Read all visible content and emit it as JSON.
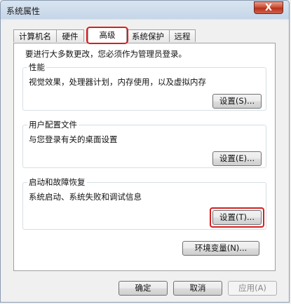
{
  "window": {
    "title": "系统属性",
    "close_glyph": "X"
  },
  "tabs": [
    "计算机名",
    "硬件",
    "高级",
    "系统保护",
    "远程"
  ],
  "admin_note": "要进行大多数更改，您必须作为管理员登录。",
  "performance": {
    "title": "性能",
    "desc": "视觉效果，处理器计划，内存使用，以及虚拟内存",
    "button": "设置(S)..."
  },
  "profiles": {
    "title": "用户配置文件",
    "desc": "与您登录有关的桌面设置",
    "button": "设置(E)..."
  },
  "startup": {
    "title": "启动和故障恢复",
    "desc": "系统启动、系统失败和调试信息",
    "button": "设置(T)..."
  },
  "env_button": "环境变量(N)...",
  "footer": {
    "ok": "确定",
    "cancel": "取消",
    "apply": "应用(A)"
  },
  "highlight_color": "#d42020"
}
